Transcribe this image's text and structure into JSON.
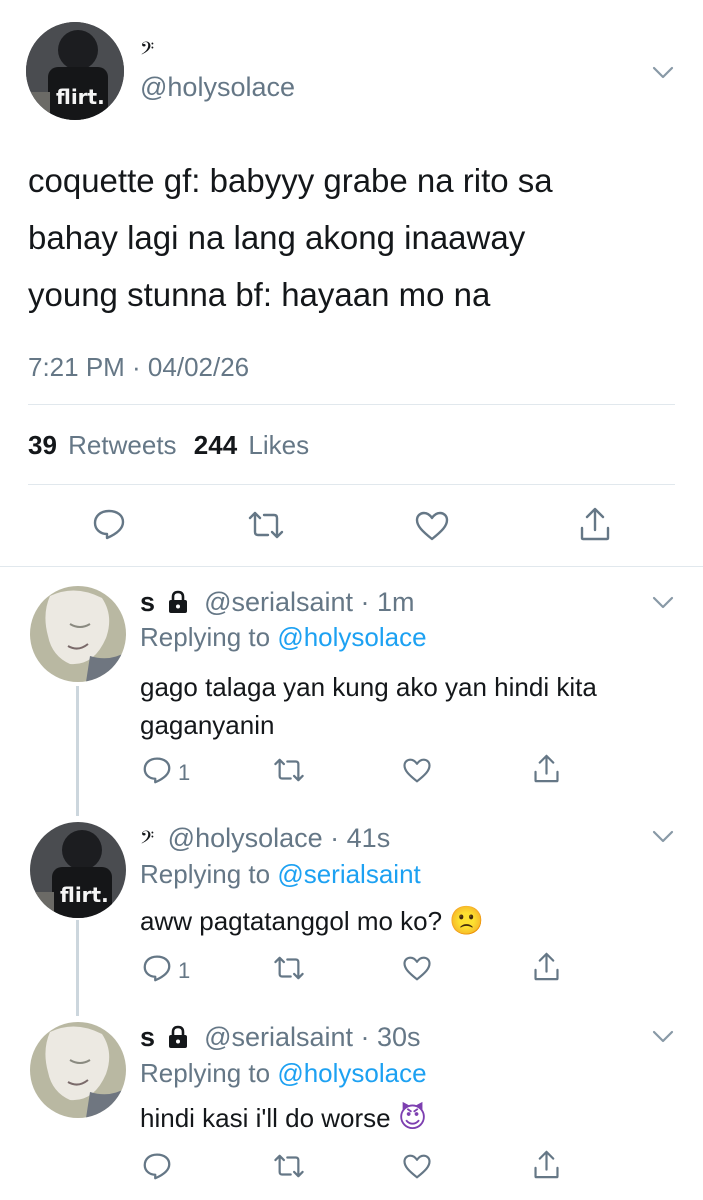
{
  "main_tweet": {
    "display_name": "𝄢",
    "handle": "@holysolace",
    "text_lines": [
      "coquette gf: babyyy grabe na rito sa",
      "bahay lagi na lang akong inaaway",
      "young stunna bf: hayaan mo na"
    ],
    "timestamp": "7:21 PM · 04/02/26",
    "avatar_text": "flirt.",
    "retweets_count": "39",
    "retweets_label": "Retweets",
    "likes_count": "244",
    "likes_label": "Likes"
  },
  "replies": [
    {
      "display_name": "s",
      "lock": "🔒",
      "handle": "@serialsaint",
      "time": " · 1m",
      "replying_prefix": "Replying to",
      "replying_to": "@holysolace",
      "text_lines": [
        "gago talaga yan kung ako yan hindi kita",
        "gaganyanin"
      ],
      "reply_count": "1"
    },
    {
      "display_name": "𝄢",
      "handle": "@holysolace",
      "time": " · 41s",
      "replying_prefix": "Replying to",
      "replying_to": "@serialsaint",
      "text": "aww pagtatanggol mo ko?",
      "emoji": "🙁",
      "avatar_text": "flirt.",
      "reply_count": "1"
    },
    {
      "display_name": "s",
      "lock": "🔒",
      "handle": "@serialsaint",
      "time": " · 30s",
      "replying_prefix": "Replying to",
      "replying_to": "@holysolace",
      "text": "hindi kasi i'll do worse",
      "emoji": "😈",
      "reply_count": ""
    }
  ],
  "icons": {
    "reply": "reply-icon",
    "retweet": "retweet-icon",
    "like": "heart-icon",
    "share": "share-icon",
    "menu": "chevron-down-icon",
    "lock": "lock-icon"
  },
  "colors": {
    "text": "#14171a",
    "secondary": "#657786",
    "link": "#1da1f2",
    "divider": "#e1e8ed",
    "thread_line": "#ccd6dd"
  }
}
